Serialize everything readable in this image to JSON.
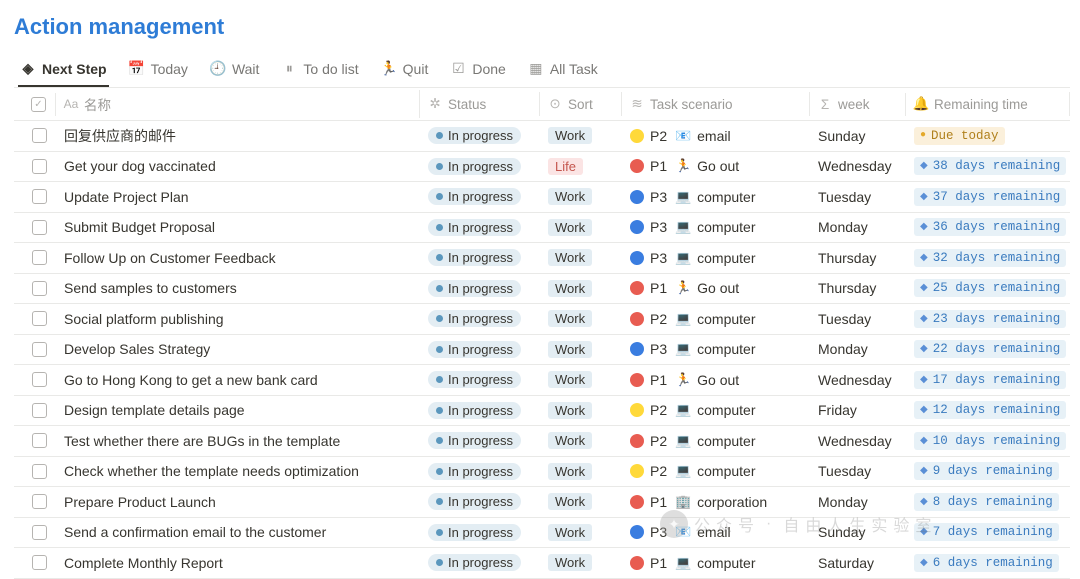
{
  "title": "Action management",
  "tabs": [
    {
      "id": "next-step",
      "label": "Next Step",
      "icon": "diamond",
      "active": true
    },
    {
      "id": "today",
      "label": "Today",
      "icon": "calendar-day"
    },
    {
      "id": "wait",
      "label": "Wait",
      "icon": "clock"
    },
    {
      "id": "todo",
      "label": "To do list",
      "icon": "pause"
    },
    {
      "id": "quit",
      "label": "Quit",
      "icon": "person-run"
    },
    {
      "id": "done",
      "label": "Done",
      "icon": "check-square"
    },
    {
      "id": "all",
      "label": "All Task",
      "icon": "calendar-grid"
    }
  ],
  "columns": {
    "name": {
      "label": "名称",
      "icon": "Aa"
    },
    "status": {
      "label": "Status",
      "icon": "spinner"
    },
    "sort": {
      "label": "Sort",
      "icon": "chevron-circle"
    },
    "scen": {
      "label": "Task scenario",
      "icon": "wave"
    },
    "week": {
      "label": "week",
      "icon": "sigma"
    },
    "remain": {
      "label": "Remaining time",
      "icon": "bell"
    }
  },
  "labels": {
    "in_progress": "In progress",
    "work": "Work",
    "life": "Life"
  },
  "priority": {
    "P1": "P1",
    "P2": "P2",
    "P3": "P3"
  },
  "scenario_types": {
    "email": {
      "icon": "📧",
      "label": "email"
    },
    "go_out": {
      "icon": "🏃",
      "label": "Go out"
    },
    "computer": {
      "icon": "💻",
      "label": "computer"
    },
    "corporation": {
      "icon": "🏢",
      "label": "corporation"
    }
  },
  "rows": [
    {
      "name": "回复供应商的邮件",
      "status": "in_progress",
      "sort": "work",
      "pri": "P2",
      "pri_color": "yellow",
      "scen": "email",
      "week": "Sunday",
      "remain": "Due today",
      "remain_style": "due"
    },
    {
      "name": "Get your dog vaccinated",
      "status": "in_progress",
      "sort": "life",
      "pri": "P1",
      "pri_color": "red",
      "scen": "go_out",
      "week": "Wednesday",
      "remain": "38 days remaining",
      "remain_style": "blue"
    },
    {
      "name": "Update Project Plan",
      "status": "in_progress",
      "sort": "work",
      "pri": "P3",
      "pri_color": "blue",
      "scen": "computer",
      "week": "Tuesday",
      "remain": "37 days remaining",
      "remain_style": "blue"
    },
    {
      "name": "Submit Budget Proposal",
      "status": "in_progress",
      "sort": "work",
      "pri": "P3",
      "pri_color": "blue",
      "scen": "computer",
      "week": "Monday",
      "remain": "36 days remaining",
      "remain_style": "blue"
    },
    {
      "name": "Follow Up on Customer Feedback",
      "status": "in_progress",
      "sort": "work",
      "pri": "P3",
      "pri_color": "blue",
      "scen": "computer",
      "week": "Thursday",
      "remain": "32 days remaining",
      "remain_style": "blue"
    },
    {
      "name": "Send samples to customers",
      "status": "in_progress",
      "sort": "work",
      "pri": "P1",
      "pri_color": "red",
      "scen": "go_out",
      "week": "Thursday",
      "remain": "25 days remaining",
      "remain_style": "blue"
    },
    {
      "name": "Social platform publishing",
      "status": "in_progress",
      "sort": "work",
      "pri": "P2",
      "pri_color": "red",
      "scen": "computer",
      "week": "Tuesday",
      "remain": "23 days remaining",
      "remain_style": "blue"
    },
    {
      "name": "Develop Sales Strategy",
      "status": "in_progress",
      "sort": "work",
      "pri": "P3",
      "pri_color": "blue",
      "scen": "computer",
      "week": "Monday",
      "remain": "22 days remaining",
      "remain_style": "blue"
    },
    {
      "name": "Go to Hong Kong to get a new bank card",
      "status": "in_progress",
      "sort": "work",
      "pri": "P1",
      "pri_color": "red",
      "scen": "go_out",
      "week": "Wednesday",
      "remain": "17 days remaining",
      "remain_style": "blue"
    },
    {
      "name": "Design template details page",
      "status": "in_progress",
      "sort": "work",
      "pri": "P2",
      "pri_color": "yellow",
      "scen": "computer",
      "week": "Friday",
      "remain": "12 days remaining",
      "remain_style": "blue"
    },
    {
      "name": "Test whether there are BUGs in the template",
      "status": "in_progress",
      "sort": "work",
      "pri": "P2",
      "pri_color": "red",
      "scen": "computer",
      "week": "Wednesday",
      "remain": "10 days remaining",
      "remain_style": "blue"
    },
    {
      "name": "Check whether the template needs optimization",
      "status": "in_progress",
      "sort": "work",
      "pri": "P2",
      "pri_color": "yellow",
      "scen": "computer",
      "week": "Tuesday",
      "remain": "9 days remaining",
      "remain_style": "blue"
    },
    {
      "name": "Prepare Product Launch",
      "status": "in_progress",
      "sort": "work",
      "pri": "P1",
      "pri_color": "red",
      "scen": "corporation",
      "week": "Monday",
      "remain": "8 days remaining",
      "remain_style": "blue"
    },
    {
      "name": "Send a confirmation email to the customer",
      "status": "in_progress",
      "sort": "work",
      "pri": "P3",
      "pri_color": "blue",
      "scen": "email",
      "week": "Sunday",
      "remain": "7 days remaining",
      "remain_style": "blue"
    },
    {
      "name": "Complete Monthly Report",
      "status": "in_progress",
      "sort": "work",
      "pri": "P1",
      "pri_color": "red",
      "scen": "computer",
      "week": "Saturday",
      "remain": "6 days remaining",
      "remain_style": "blue"
    }
  ],
  "watermark": {
    "prefix": "公众号",
    "suffix": "自由人生实验室"
  }
}
